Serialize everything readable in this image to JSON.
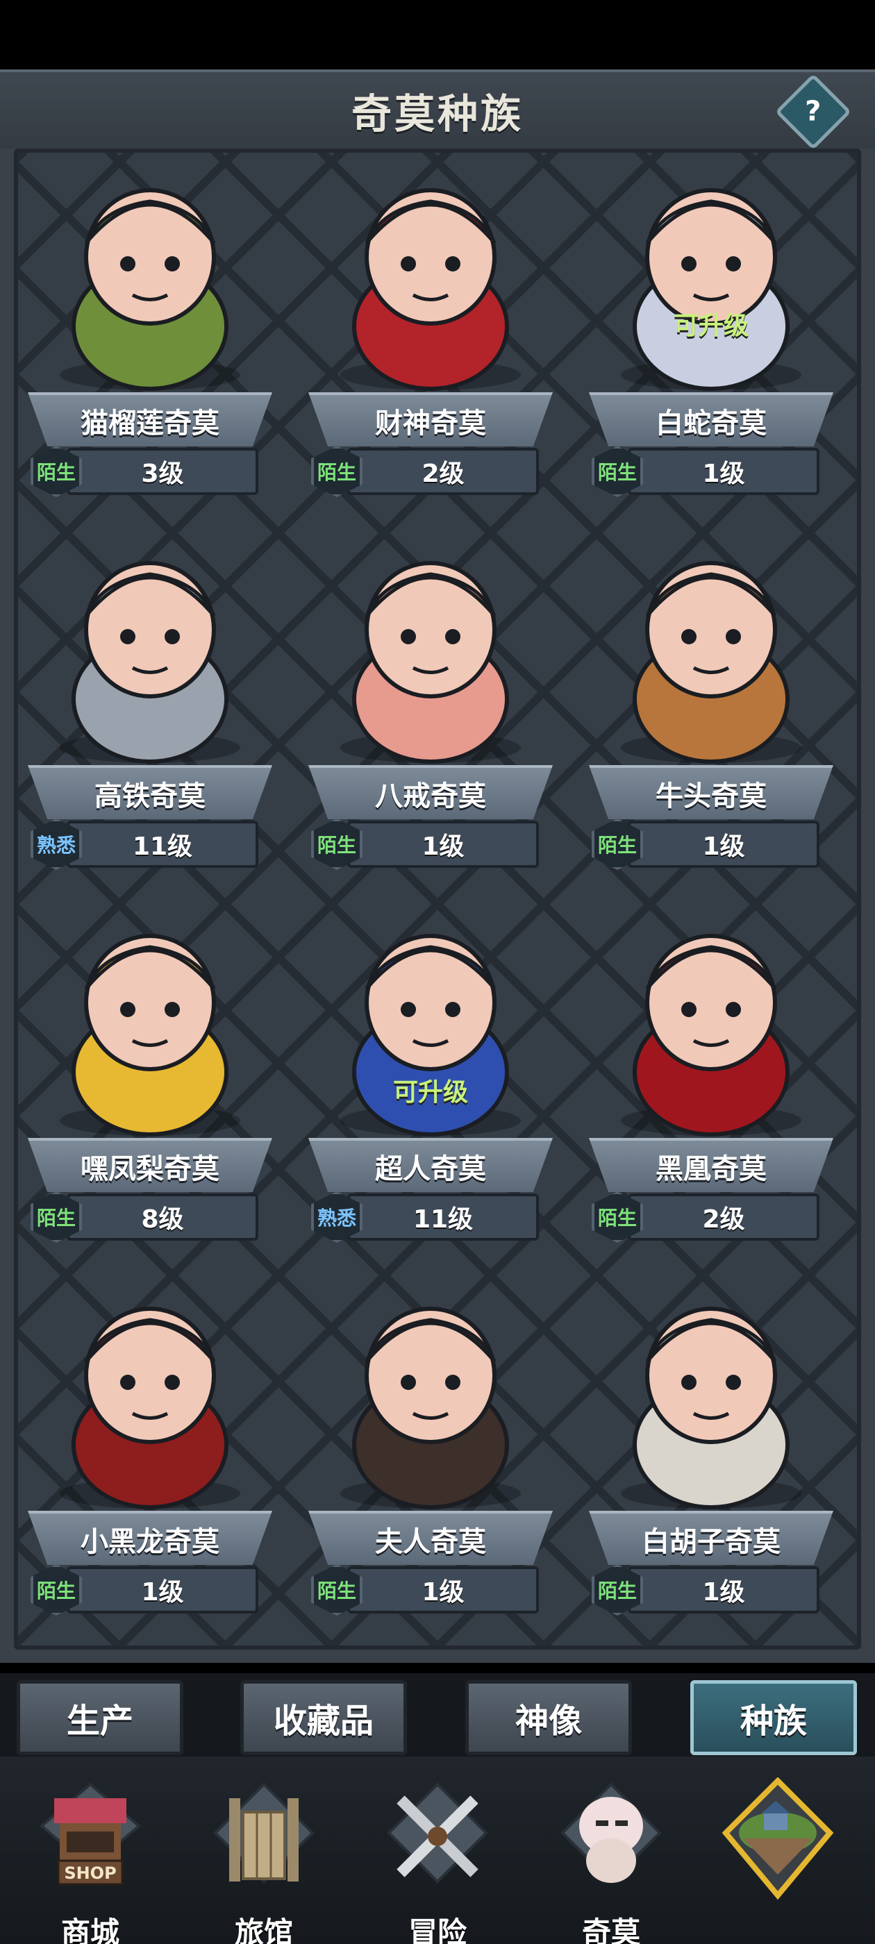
{
  "header": {
    "title": "奇莫种族",
    "help_label": "?"
  },
  "cards": [
    {
      "name": "猫榴莲奇莫",
      "level": "3级",
      "status": "陌生",
      "status_type": "stranger",
      "upgrade_label": "",
      "icon": "durian-cat-portrait-icon",
      "color": "#6f8f3a"
    },
    {
      "name": "财神奇莫",
      "level": "2级",
      "status": "陌生",
      "status_type": "stranger",
      "upgrade_label": "",
      "icon": "god-of-wealth-portrait-icon",
      "color": "#b3232a"
    },
    {
      "name": "白蛇奇莫",
      "level": "1级",
      "status": "陌生",
      "status_type": "stranger",
      "upgrade_label": "可升级",
      "icon": "white-snake-portrait-icon",
      "color": "#c9cfe0"
    },
    {
      "name": "高铁奇莫",
      "level": "11级",
      "status": "熟悉",
      "status_type": "familiar",
      "upgrade_label": "",
      "icon": "bullet-train-portrait-icon",
      "color": "#9aa3ad"
    },
    {
      "name": "八戒奇莫",
      "level": "1级",
      "status": "陌生",
      "status_type": "stranger",
      "upgrade_label": "",
      "icon": "pig-portrait-icon",
      "color": "#e79a8e"
    },
    {
      "name": "牛头奇莫",
      "level": "1级",
      "status": "陌生",
      "status_type": "stranger",
      "upgrade_label": "",
      "icon": "ox-head-portrait-icon",
      "color": "#b8763c"
    },
    {
      "name": "嘿凤梨奇莫",
      "level": "8级",
      "status": "陌生",
      "status_type": "stranger",
      "upgrade_label": "",
      "icon": "pineapple-portrait-icon",
      "color": "#e7b832"
    },
    {
      "name": "超人奇莫",
      "level": "11级",
      "status": "熟悉",
      "status_type": "familiar",
      "upgrade_label": "可升级",
      "icon": "superhero-portrait-icon",
      "color": "#2f4fb0"
    },
    {
      "name": "黑凰奇莫",
      "level": "2级",
      "status": "陌生",
      "status_type": "stranger",
      "upgrade_label": "",
      "icon": "dark-phoenix-portrait-icon",
      "color": "#a0161e"
    },
    {
      "name": "小黑龙奇莫",
      "level": "1级",
      "status": "陌生",
      "status_type": "stranger",
      "upgrade_label": "",
      "icon": "black-dragon-portrait-icon",
      "color": "#8e1d1d"
    },
    {
      "name": "夫人奇莫",
      "level": "1级",
      "status": "陌生",
      "status_type": "stranger",
      "upgrade_label": "",
      "icon": "lady-portrait-icon",
      "color": "#3d2f2a"
    },
    {
      "name": "白胡子奇莫",
      "level": "1级",
      "status": "陌生",
      "status_type": "stranger",
      "upgrade_label": "",
      "icon": "whitebeard-portrait-icon",
      "color": "#d9d5cc"
    }
  ],
  "tabs": [
    {
      "label": "生产",
      "active": false
    },
    {
      "label": "收藏品",
      "active": false
    },
    {
      "label": "神像",
      "active": false
    },
    {
      "label": "种族",
      "active": true
    }
  ],
  "bottom_nav": [
    {
      "label": "商城",
      "icon": "shop-icon",
      "sign_text": "SHOP"
    },
    {
      "label": "旅馆",
      "icon": "inn-gate-icon"
    },
    {
      "label": "冒险",
      "icon": "crossed-swords-icon"
    },
    {
      "label": "奇莫",
      "icon": "qimo-character-icon"
    },
    {
      "label": "",
      "icon": "floating-island-icon"
    }
  ],
  "colors": {
    "stranger": "#7ee27a",
    "familiar": "#7cc4ff",
    "upgrade": "#c8f27a",
    "active_tab": "#3c6e7e"
  }
}
